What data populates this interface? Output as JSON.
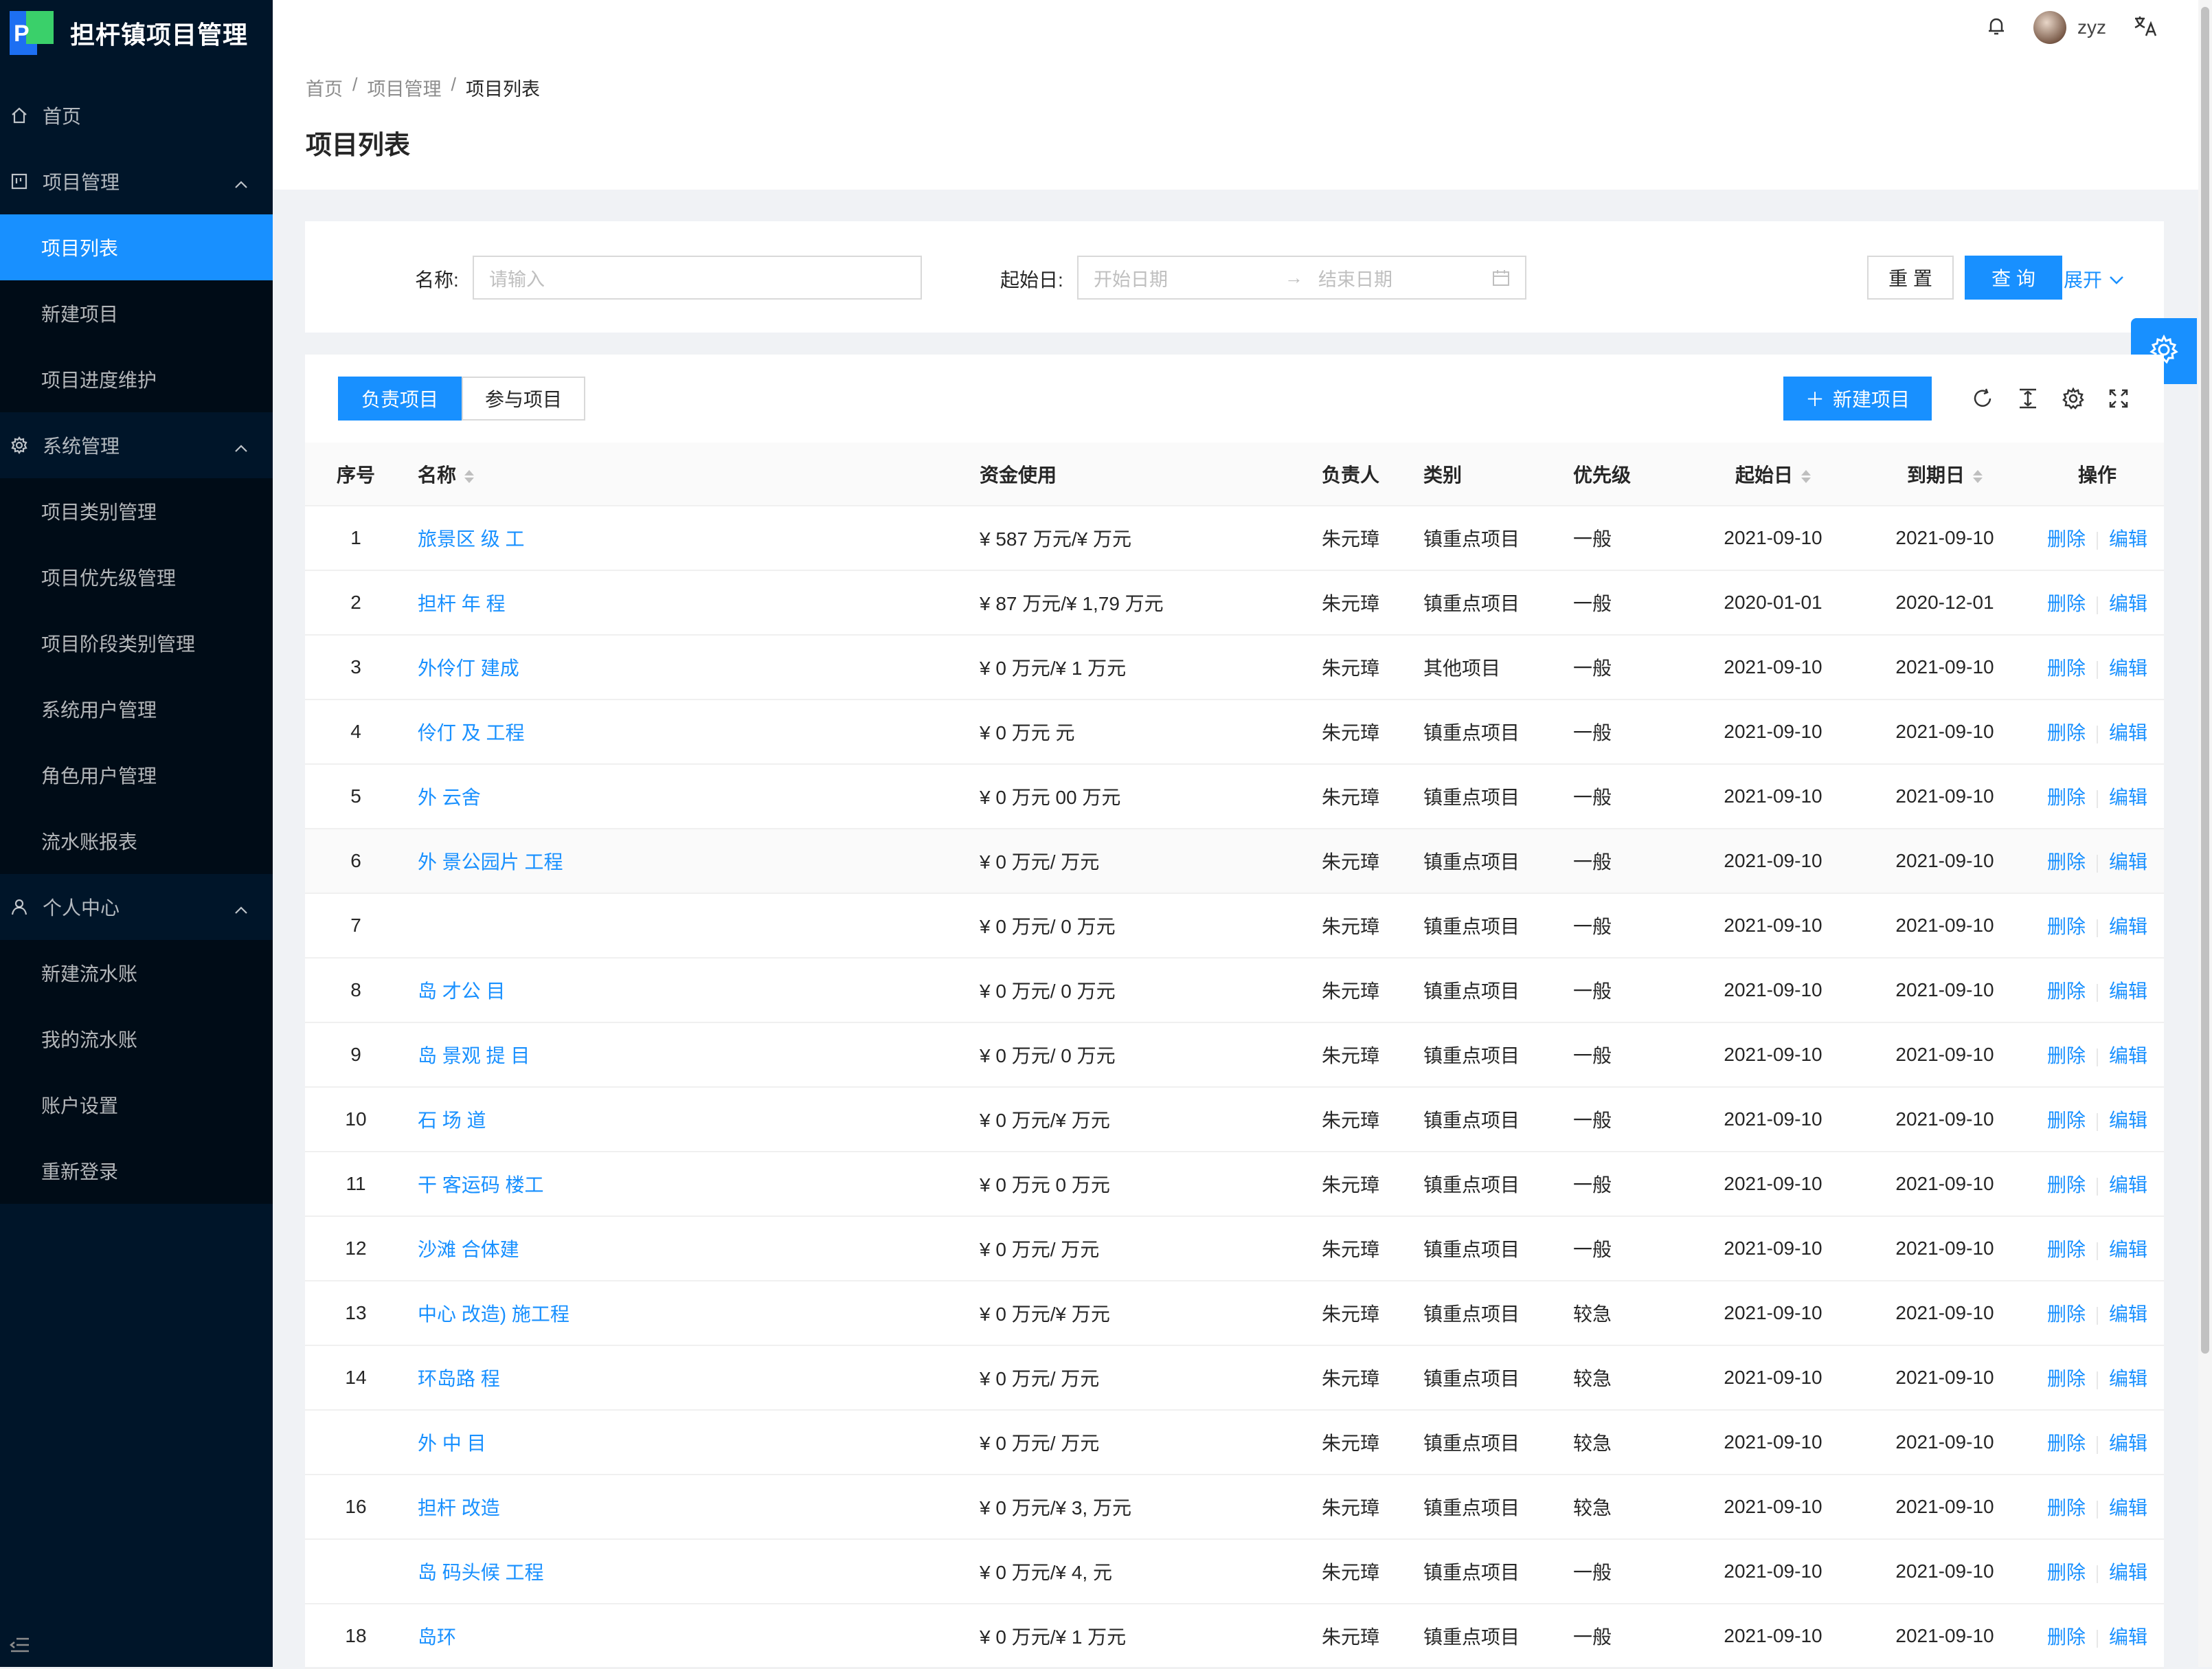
{
  "app": {
    "title": "担杆镇项目管理",
    "logo_text": "P"
  },
  "sidebar": {
    "items": [
      {
        "label": "首页",
        "type": "top",
        "icon": "home-icon"
      },
      {
        "label": "项目管理",
        "type": "top",
        "icon": "project-icon",
        "expanded": true
      },
      {
        "label": "项目列表",
        "type": "sub",
        "active": true
      },
      {
        "label": "新建项目",
        "type": "sub"
      },
      {
        "label": "项目进度维护",
        "type": "sub"
      },
      {
        "label": "系统管理",
        "type": "top",
        "icon": "gear-icon",
        "expanded": true
      },
      {
        "label": "项目类别管理",
        "type": "sub"
      },
      {
        "label": "项目优先级管理",
        "type": "sub"
      },
      {
        "label": "项目阶段类别管理",
        "type": "sub"
      },
      {
        "label": "系统用户管理",
        "type": "sub"
      },
      {
        "label": "角色用户管理",
        "type": "sub"
      },
      {
        "label": "流水账报表",
        "type": "sub"
      },
      {
        "label": "个人中心",
        "type": "top",
        "icon": "user-icon",
        "expanded": true
      },
      {
        "label": "新建流水账",
        "type": "sub"
      },
      {
        "label": "我的流水账",
        "type": "sub"
      },
      {
        "label": "账户设置",
        "type": "sub"
      },
      {
        "label": "重新登录",
        "type": "sub"
      }
    ]
  },
  "header": {
    "username": "zyz"
  },
  "breadcrumb": {
    "home": "首页",
    "section": "项目管理",
    "current": "项目列表",
    "separator": "/"
  },
  "page": {
    "title": "项目列表"
  },
  "search": {
    "name_label": "名称:",
    "name_placeholder": "请输入",
    "start_label": "起始日:",
    "start_placeholder": "开始日期",
    "end_placeholder": "结束日期",
    "reset_label": "重 置",
    "query_label": "查 询",
    "expand_label": "展开"
  },
  "tabs": [
    {
      "label": "负责项目",
      "active": true
    },
    {
      "label": "参与项目",
      "active": false
    }
  ],
  "toolbar": {
    "new_label": "新建项目"
  },
  "table": {
    "columns": {
      "index": "序号",
      "name": "名称",
      "funds": "资金使用",
      "owner": "负责人",
      "category": "类别",
      "priority": "优先级",
      "start": "起始日",
      "end": "到期日",
      "ops": "操作"
    },
    "delete_label": "删除",
    "edit_label": "编辑",
    "rows": [
      {
        "index": "1",
        "name": "旅景区 级 工",
        "funds": "¥ 587 万元/¥ 万元",
        "owner": "朱元璋",
        "category": "镇重点项目",
        "priority": "一般",
        "start": "2021-09-10",
        "end": "2021-09-10"
      },
      {
        "index": "2",
        "name": "担杆 年 程",
        "funds": "¥ 87 万元/¥ 1,79 万元",
        "owner": "朱元璋",
        "category": "镇重点项目",
        "priority": "一般",
        "start": "2020-01-01",
        "end": "2020-12-01"
      },
      {
        "index": "3",
        "name": "外伶仃 建成",
        "funds": "¥ 0 万元/¥ 1 万元",
        "owner": "朱元璋",
        "category": "其他项目",
        "priority": "一般",
        "start": "2021-09-10",
        "end": "2021-09-10"
      },
      {
        "index": "4",
        "name": "伶仃 及 工程",
        "funds": "¥ 0 万元 元",
        "owner": "朱元璋",
        "category": "镇重点项目",
        "priority": "一般",
        "start": "2021-09-10",
        "end": "2021-09-10"
      },
      {
        "index": "5",
        "name": "外 云舍",
        "funds": "¥ 0 万元 00 万元",
        "owner": "朱元璋",
        "category": "镇重点项目",
        "priority": "一般",
        "start": "2021-09-10",
        "end": "2021-09-10"
      },
      {
        "index": "6",
        "name": "外 景公园片 工程",
        "funds": "¥ 0 万元/ 万元",
        "owner": "朱元璋",
        "category": "镇重点项目",
        "priority": "一般",
        "start": "2021-09-10",
        "end": "2021-09-10"
      },
      {
        "index": "7",
        "name": "",
        "funds": "¥ 0 万元/ 0 万元",
        "owner": "朱元璋",
        "category": "镇重点项目",
        "priority": "一般",
        "start": "2021-09-10",
        "end": "2021-09-10"
      },
      {
        "index": "8",
        "name": "岛 才公 目",
        "funds": "¥ 0 万元/ 0 万元",
        "owner": "朱元璋",
        "category": "镇重点项目",
        "priority": "一般",
        "start": "2021-09-10",
        "end": "2021-09-10"
      },
      {
        "index": "9",
        "name": "岛 景观 提 目",
        "funds": "¥ 0 万元/ 0 万元",
        "owner": "朱元璋",
        "category": "镇重点项目",
        "priority": "一般",
        "start": "2021-09-10",
        "end": "2021-09-10"
      },
      {
        "index": "10",
        "name": "石 场 道",
        "funds": "¥ 0 万元/¥ 万元",
        "owner": "朱元璋",
        "category": "镇重点项目",
        "priority": "一般",
        "start": "2021-09-10",
        "end": "2021-09-10"
      },
      {
        "index": "11",
        "name": "干 客运码 楼工",
        "funds": "¥ 0 万元 0 万元",
        "owner": "朱元璋",
        "category": "镇重点项目",
        "priority": "一般",
        "start": "2021-09-10",
        "end": "2021-09-10"
      },
      {
        "index": "12",
        "name": "沙滩 合体建",
        "funds": "¥ 0 万元/ 万元",
        "owner": "朱元璋",
        "category": "镇重点项目",
        "priority": "一般",
        "start": "2021-09-10",
        "end": "2021-09-10"
      },
      {
        "index": "13",
        "name": "中心 改造) 施工程",
        "funds": "¥ 0 万元/¥ 万元",
        "owner": "朱元璋",
        "category": "镇重点项目",
        "priority": "较急",
        "start": "2021-09-10",
        "end": "2021-09-10"
      },
      {
        "index": "14",
        "name": "环岛路 程",
        "funds": "¥ 0 万元/ 万元",
        "owner": "朱元璋",
        "category": "镇重点项目",
        "priority": "较急",
        "start": "2021-09-10",
        "end": "2021-09-10"
      },
      {
        "index": "",
        "name": "外 中 目",
        "funds": "¥ 0 万元/ 万元",
        "owner": "朱元璋",
        "category": "镇重点项目",
        "priority": "较急",
        "start": "2021-09-10",
        "end": "2021-09-10"
      },
      {
        "index": "16",
        "name": "担杆 改造",
        "funds": "¥ 0 万元/¥ 3, 万元",
        "owner": "朱元璋",
        "category": "镇重点项目",
        "priority": "较急",
        "start": "2021-09-10",
        "end": "2021-09-10"
      },
      {
        "index": "",
        "name": "岛 码头候 工程",
        "funds": "¥ 0 万元/¥ 4, 元",
        "owner": "朱元璋",
        "category": "镇重点项目",
        "priority": "一般",
        "start": "2021-09-10",
        "end": "2021-09-10"
      },
      {
        "index": "18",
        "name": "岛环",
        "funds": "¥ 0 万元/¥ 1 万元",
        "owner": "朱元璋",
        "category": "镇重点项目",
        "priority": "一般",
        "start": "2021-09-10",
        "end": "2021-09-10"
      }
    ]
  },
  "colors": {
    "primary": "#1890ff",
    "sidebar_bg": "#001529",
    "sidebar_sub_bg": "#000c17"
  }
}
